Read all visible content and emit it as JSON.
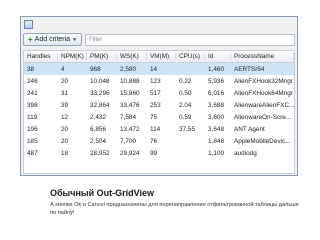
{
  "window": {
    "filter_bar": {
      "add_criteria_label": "Add criteria",
      "filter_placeholder": "Filter"
    },
    "grid": {
      "columns": [
        "Handles",
        "NPM(K)",
        "PM(K)",
        "WS(K)",
        "VM(M)",
        "CPU(s)",
        "Id",
        "ProcessName"
      ],
      "rows": [
        [
          "38",
          "4",
          "968",
          "2,580",
          "14",
          "",
          "1,460",
          "AERTSr64"
        ],
        [
          "246",
          "20",
          "10,048",
          "10,888",
          "123",
          "0.22",
          "5,936",
          "AlienFXHook32Mngr"
        ],
        [
          "241",
          "31",
          "33,296",
          "15,960",
          "517",
          "0.50",
          "6,016",
          "AlienFXHook64Mngr"
        ],
        [
          "398",
          "39",
          "32,864",
          "33,476",
          "253",
          "2.04",
          "3,688",
          "AlienwareAlienFXC..."
        ],
        [
          "119",
          "12",
          "2,432",
          "7,584",
          "75",
          "0.59",
          "3,600",
          "AlienwareOn-Scre..."
        ],
        [
          "196",
          "20",
          "6,856",
          "13,472",
          "114",
          "37.55",
          "3,648",
          "ANT Agent"
        ],
        [
          "185",
          "20",
          "2,504",
          "7,700",
          "76",
          "",
          "1,848",
          "AppleMobileDevic..."
        ],
        [
          "487",
          "18",
          "28,952",
          "29,924",
          "99",
          "",
          "1,100",
          "audiodg"
        ]
      ],
      "selected_row": 0
    }
  },
  "caption": {
    "title": "Обычный Out-GridView",
    "text": "А кнопки Ok и Cancel предназначены для перенаправления отфильтрованной таблицы дальше по пайпу!"
  },
  "colors": {
    "selected_row": "#cde4f7",
    "window_border": "#8a9bb5"
  }
}
